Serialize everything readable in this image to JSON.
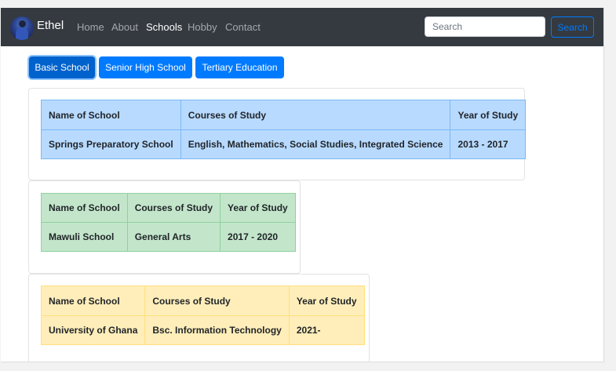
{
  "navbar": {
    "brand": "Ethel",
    "links": [
      "Home",
      "About",
      "Schools",
      "Hobby",
      "Contact"
    ],
    "active_link": "Schools",
    "search": {
      "placeholder": "Search",
      "value": "",
      "button_label": "Search"
    }
  },
  "tabs": [
    {
      "label": "Basic School",
      "active": true
    },
    {
      "label": "Senior High School",
      "active": false
    },
    {
      "label": "Tertiary Education",
      "active": false
    }
  ],
  "tables": [
    {
      "headers": [
        "Name of School",
        "Courses of Study",
        "Year of Study"
      ],
      "rows": [
        [
          "Springs Preparatory School",
          "English, Mathematics, Social Studies, Integrated Science",
          "2013 - 2017"
        ]
      ]
    },
    {
      "headers": [
        "Name of School",
        "Courses of Study",
        "Year of Study"
      ],
      "rows": [
        [
          "Mawuli School",
          "General Arts",
          "2017 - 2020"
        ]
      ]
    },
    {
      "headers": [
        "Name of School",
        "Courses of Study",
        "Year of Study"
      ],
      "rows": [
        [
          "University of Ghana",
          "Bsc. Information Technology",
          "2021-"
        ]
      ]
    }
  ],
  "colors": {
    "navbar": "#343a40",
    "primary": "#007bff",
    "table_basic": "#b8daff",
    "table_shs": "#c3e6cb",
    "table_tertiary": "#ffeeba"
  }
}
